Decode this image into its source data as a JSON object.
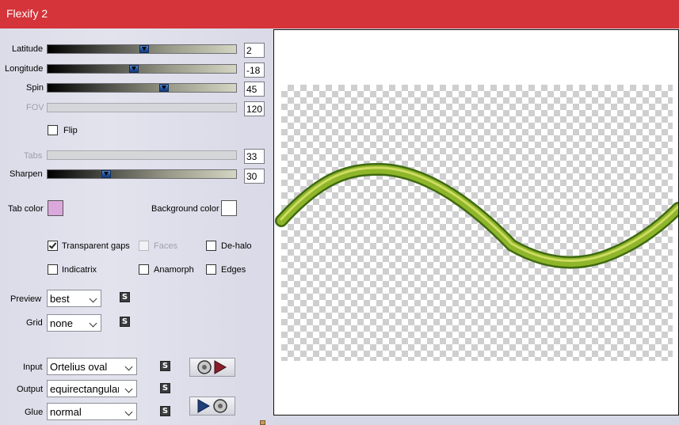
{
  "window": {
    "title": "Flexify 2",
    "accent_color": "#d4343a"
  },
  "sliders": [
    {
      "label": "Latitude",
      "value": "2",
      "enabled": true,
      "level": 0.52
    },
    {
      "label": "Longitude",
      "value": "-18",
      "enabled": true,
      "level": 0.46
    },
    {
      "label": "Spin",
      "value": "45",
      "enabled": true,
      "level": 0.62
    },
    {
      "label": "FOV",
      "value": "120",
      "enabled": false
    },
    {
      "label": "Tabs",
      "value": "33",
      "enabled": false
    },
    {
      "label": "Sharpen",
      "value": "30",
      "enabled": true,
      "level": 0.3
    }
  ],
  "flip": {
    "label": "Flip",
    "checked": false
  },
  "tab_color": {
    "label": "Tab color",
    "color": "#dba8db"
  },
  "background_color": {
    "label": "Background color",
    "color": "#ffffff"
  },
  "options": {
    "transparent_gaps": {
      "label": "Transparent gaps",
      "checked": true
    },
    "faces": {
      "label": "Faces",
      "checked": false,
      "enabled": false
    },
    "de_halo": {
      "label": "De-halo",
      "checked": false
    },
    "indicatrix": {
      "label": "Indicatrix",
      "checked": false
    },
    "anamorph": {
      "label": "Anamorph",
      "checked": false
    },
    "edges": {
      "label": "Edges",
      "checked": false
    }
  },
  "preview_select": {
    "label": "Preview",
    "value": "best"
  },
  "grid_select": {
    "label": "Grid",
    "value": "none"
  },
  "input_select": {
    "label": "Input",
    "value": "Ortelius oval"
  },
  "output_select": {
    "label": "Output",
    "value": "equirectangular"
  },
  "glue_select": {
    "label": "Glue",
    "value": "normal"
  },
  "lock_glyph": "S",
  "icons": {
    "input_button": "disc-to-arrow-icon",
    "glue_button": "arrow-to-disc-icon",
    "lock": "lock-icon"
  },
  "preview_image": {
    "stroke_color": "#8fb52a"
  }
}
